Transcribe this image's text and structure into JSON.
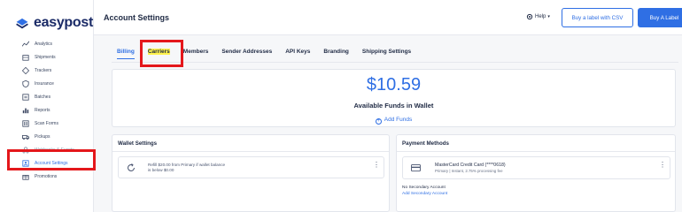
{
  "brand": {
    "name": "easypost",
    "accent": "#2f6fe4",
    "logo_color": "#1b2b67"
  },
  "sidebar": {
    "items": [
      {
        "label": "Analytics",
        "icon": "analytics-icon"
      },
      {
        "label": "Shipments",
        "icon": "shipments-icon"
      },
      {
        "label": "Trackers",
        "icon": "trackers-icon"
      },
      {
        "label": "Insurance",
        "icon": "insurance-icon"
      },
      {
        "label": "Batches",
        "icon": "batches-icon"
      },
      {
        "label": "Reports",
        "icon": "reports-icon"
      },
      {
        "label": "Scan Forms",
        "icon": "scan-forms-icon"
      },
      {
        "label": "Pickups",
        "icon": "pickups-icon"
      },
      {
        "label": "Webhooks & Events",
        "icon": "webhooks-icon"
      },
      {
        "label": "Account Settings",
        "icon": "account-settings-icon",
        "active": true
      },
      {
        "label": "Promotions",
        "icon": "promotions-icon"
      }
    ]
  },
  "header": {
    "title": "Account Settings",
    "help_label": "Help",
    "csv_button": "Buy a label with CSV",
    "buy_button": "Buy A Label"
  },
  "tabs": [
    {
      "label": "Billing",
      "active": true
    },
    {
      "label": "Carriers",
      "highlighted": true
    },
    {
      "label": "Members"
    },
    {
      "label": "Sender Addresses"
    },
    {
      "label": "API Keys"
    },
    {
      "label": "Branding"
    },
    {
      "label": "Shipping Settings"
    }
  ],
  "wallet": {
    "amount": "$10.59",
    "label": "Available Funds in Wallet",
    "add_funds": "Add Funds"
  },
  "wallet_settings": {
    "title": "Wallet Settings",
    "refill_line1": "Refill $20.00 from Primary if wallet balance",
    "refill_line2": "is below $0.00"
  },
  "payment_methods": {
    "title": "Payment Methods",
    "card_title": "MasterCard Credit Card (****0618)",
    "card_sub": "Primary | Instant, 2.75% processing fee",
    "no_secondary": "No Secondary Account",
    "add_secondary": "Add Secondary Account"
  },
  "annotation_color": "#e4171b"
}
